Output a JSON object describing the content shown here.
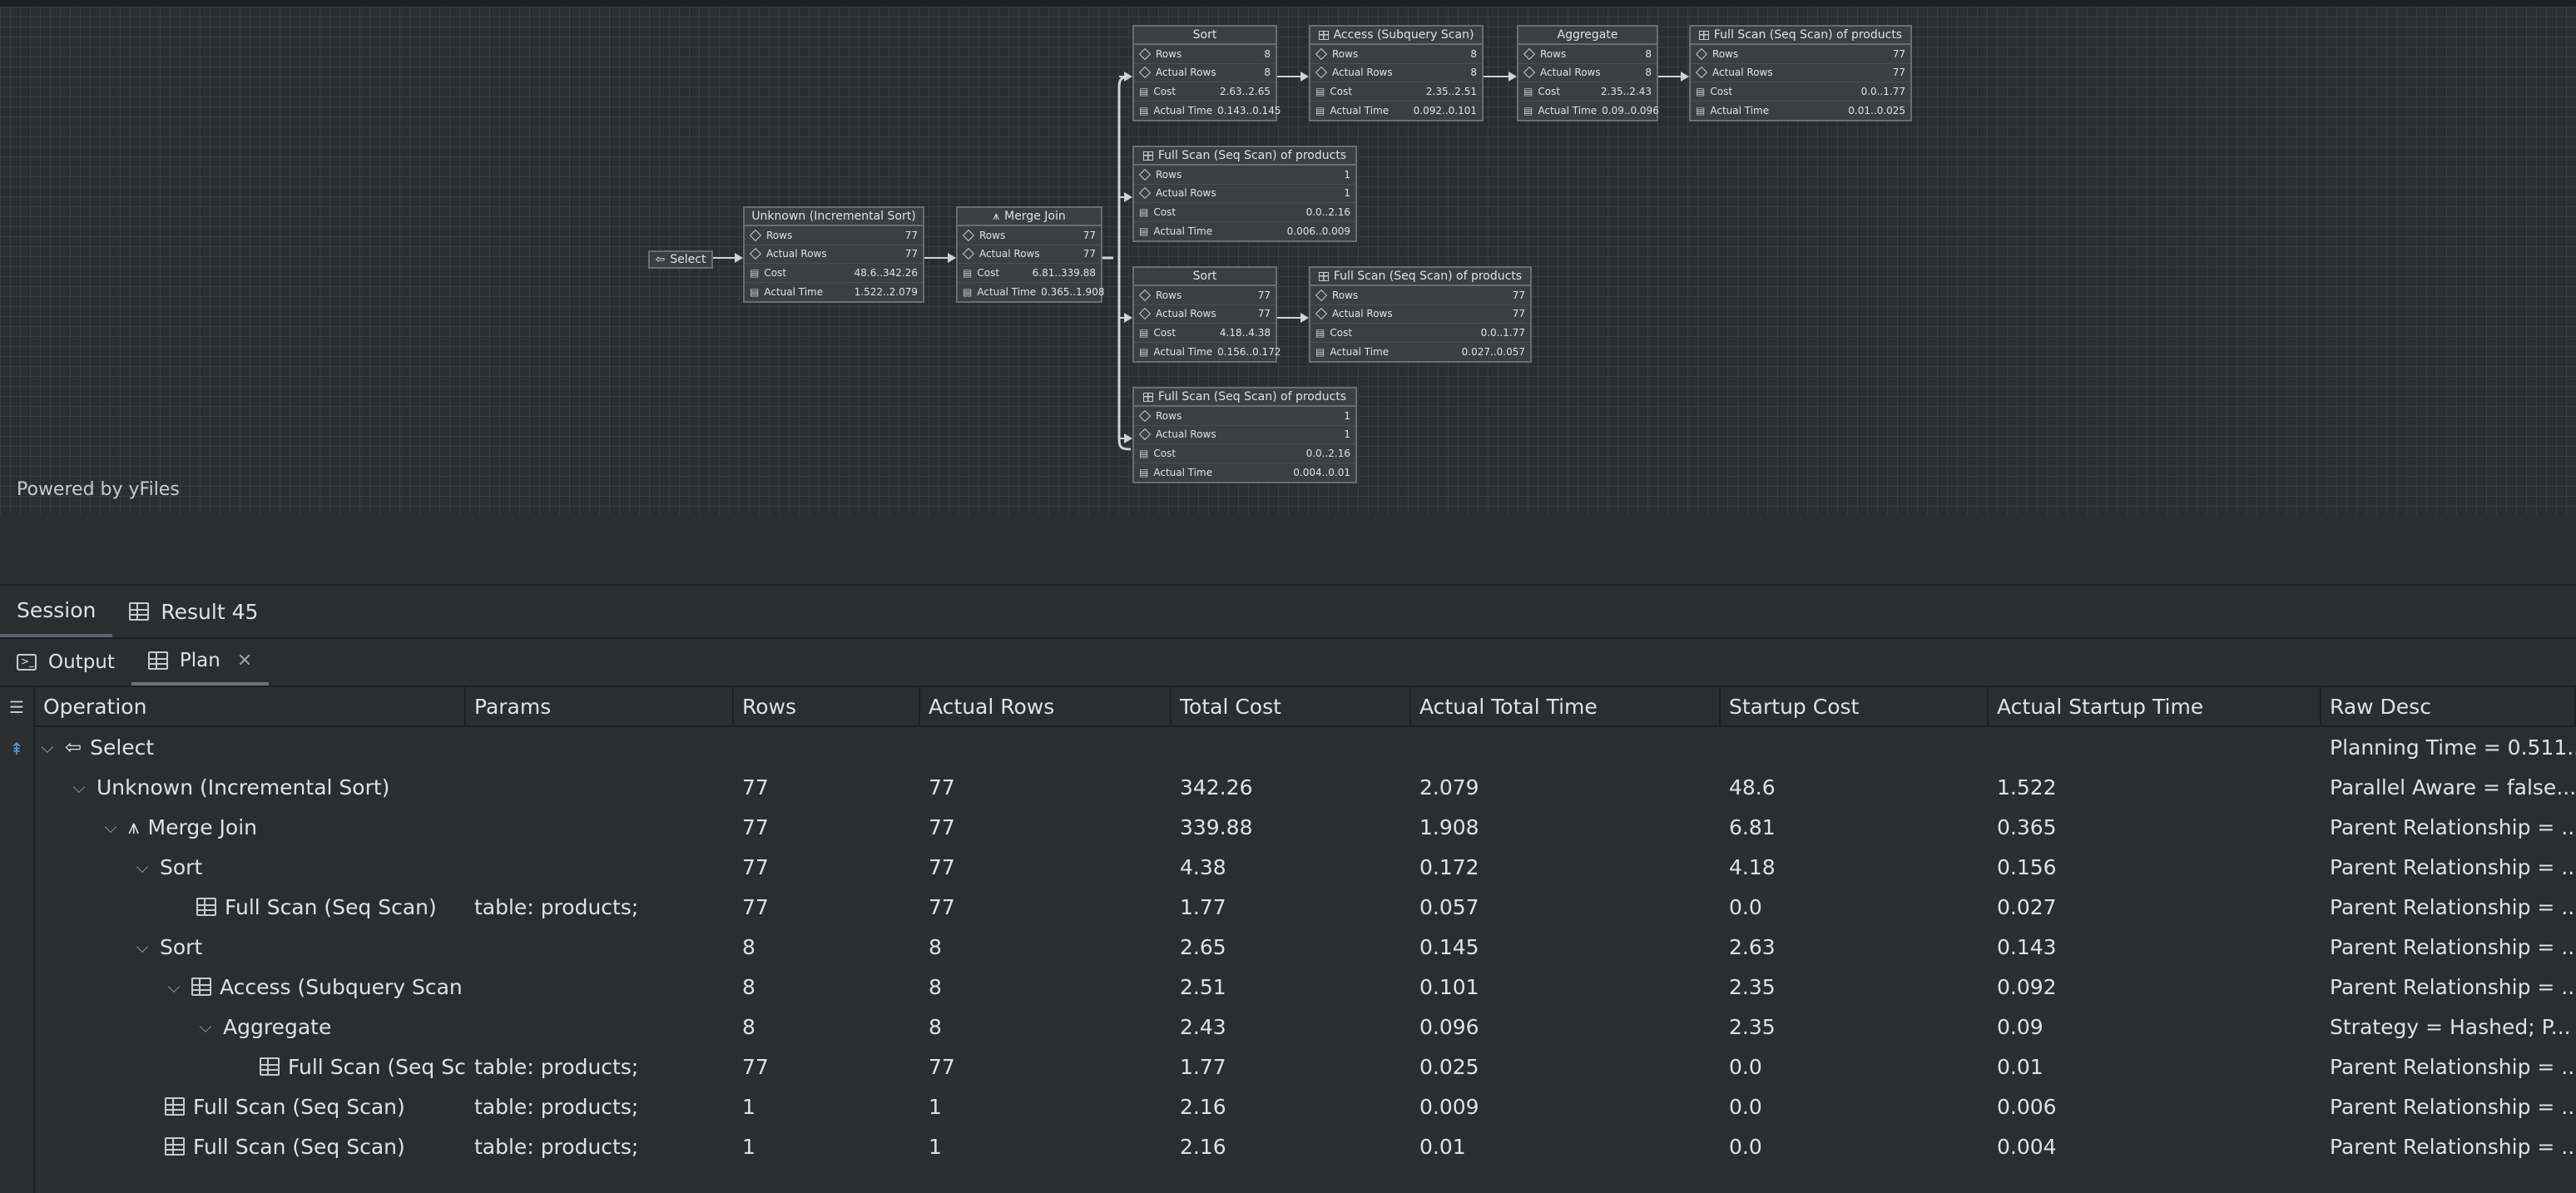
{
  "diagram": {
    "powered_by": "Powered by yFiles",
    "select_label": "Select",
    "nodes": {
      "incsort": {
        "title": "Unknown (Incremental Sort)",
        "rows": "77",
        "actual_rows": "77",
        "cost": "48.6..342.26",
        "actual_time": "1.522..2.079"
      },
      "mergejoin": {
        "title": "Merge Join",
        "rows": "77",
        "actual_rows": "77",
        "cost": "6.81..339.88",
        "actual_time": "0.365..1.908"
      },
      "sort1": {
        "title": "Sort",
        "rows": "8",
        "actual_rows": "8",
        "cost": "2.63..2.65",
        "actual_time": "0.143..0.145"
      },
      "subq": {
        "title": "Access (Subquery Scan)",
        "rows": "8",
        "actual_rows": "8",
        "cost": "2.35..2.51",
        "actual_time": "0.092..0.101"
      },
      "agg": {
        "title": "Aggregate",
        "rows": "8",
        "actual_rows": "8",
        "cost": "2.35..2.43",
        "actual_time": "0.09..0.096"
      },
      "fs1": {
        "title": "Full Scan (Seq Scan) of products",
        "rows": "77",
        "actual_rows": "77",
        "cost": "0.0..1.77",
        "actual_time": "0.01..0.025"
      },
      "fs2": {
        "title": "Full Scan (Seq Scan) of products",
        "rows": "1",
        "actual_rows": "1",
        "cost": "0.0..2.16",
        "actual_time": "0.006..0.009"
      },
      "sort2": {
        "title": "Sort",
        "rows": "77",
        "actual_rows": "77",
        "cost": "4.18..4.38",
        "actual_time": "0.156..0.172"
      },
      "fs3": {
        "title": "Full Scan (Seq Scan) of products",
        "rows": "77",
        "actual_rows": "77",
        "cost": "0.0..1.77",
        "actual_time": "0.027..0.057"
      },
      "fs4": {
        "title": "Full Scan (Seq Scan) of products",
        "rows": "1",
        "actual_rows": "1",
        "cost": "0.0..2.16",
        "actual_time": "0.004..0.01"
      }
    },
    "row_labels": {
      "rows": "Rows",
      "actual_rows": "Actual Rows",
      "cost": "Cost",
      "actual_time": "Actual Time"
    }
  },
  "tool_tabs": {
    "session": "Session",
    "result": "Result 45"
  },
  "sub_tabs": {
    "output": "Output",
    "plan": "Plan"
  },
  "table": {
    "columns": [
      "Operation",
      "Params",
      "Rows",
      "Actual Rows",
      "Total Cost",
      "Actual Total Time",
      "Startup Cost",
      "Actual Startup Time",
      "Raw Desc"
    ],
    "rows": [
      {
        "op": "Select",
        "params": "",
        "rows": "",
        "arows": "",
        "tcost": "",
        "atime": "",
        "scost": "",
        "astime": "",
        "raw": "Planning Time = 0.511..."
      },
      {
        "op": "Unknown (Incremental Sort)",
        "params": "",
        "rows": "77",
        "arows": "77",
        "tcost": "342.26",
        "atime": "2.079",
        "scost": "48.6",
        "astime": "1.522",
        "raw": "Parallel Aware = false..."
      },
      {
        "op": "Merge Join",
        "params": "",
        "rows": "77",
        "arows": "77",
        "tcost": "339.88",
        "atime": "1.908",
        "scost": "6.81",
        "astime": "0.365",
        "raw": "Parent Relationship = ..."
      },
      {
        "op": "Sort",
        "params": "",
        "rows": "77",
        "arows": "77",
        "tcost": "4.38",
        "atime": "0.172",
        "scost": "4.18",
        "astime": "0.156",
        "raw": "Parent Relationship = ..."
      },
      {
        "op": "Full Scan (Seq Scan)",
        "params": "table: products;",
        "rows": "77",
        "arows": "77",
        "tcost": "1.77",
        "atime": "0.057",
        "scost": "0.0",
        "astime": "0.027",
        "raw": "Parent Relationship = ..."
      },
      {
        "op": "Sort",
        "params": "",
        "rows": "8",
        "arows": "8",
        "tcost": "2.65",
        "atime": "0.145",
        "scost": "2.63",
        "astime": "0.143",
        "raw": "Parent Relationship = ..."
      },
      {
        "op": "Access (Subquery Scan",
        "params": "",
        "rows": "8",
        "arows": "8",
        "tcost": "2.51",
        "atime": "0.101",
        "scost": "2.35",
        "astime": "0.092",
        "raw": "Parent Relationship = ..."
      },
      {
        "op": "Aggregate",
        "params": "",
        "rows": "8",
        "arows": "8",
        "tcost": "2.43",
        "atime": "0.096",
        "scost": "2.35",
        "astime": "0.09",
        "raw": "Strategy = Hashed; P..."
      },
      {
        "op": "Full Scan (Seq Sc",
        "params": "table: products;",
        "rows": "77",
        "arows": "77",
        "tcost": "1.77",
        "atime": "0.025",
        "scost": "0.0",
        "astime": "0.01",
        "raw": "Parent Relationship = ..."
      },
      {
        "op": "Full Scan (Seq Scan)",
        "params": "table: products;",
        "rows": "1",
        "arows": "1",
        "tcost": "2.16",
        "atime": "0.009",
        "scost": "0.0",
        "astime": "0.006",
        "raw": "Parent Relationship = ..."
      },
      {
        "op": "Full Scan (Seq Scan)",
        "params": "table: products;",
        "rows": "1",
        "arows": "1",
        "tcost": "2.16",
        "atime": "0.01",
        "scost": "0.0",
        "astime": "0.004",
        "raw": "Parent Relationship = ..."
      }
    ]
  }
}
